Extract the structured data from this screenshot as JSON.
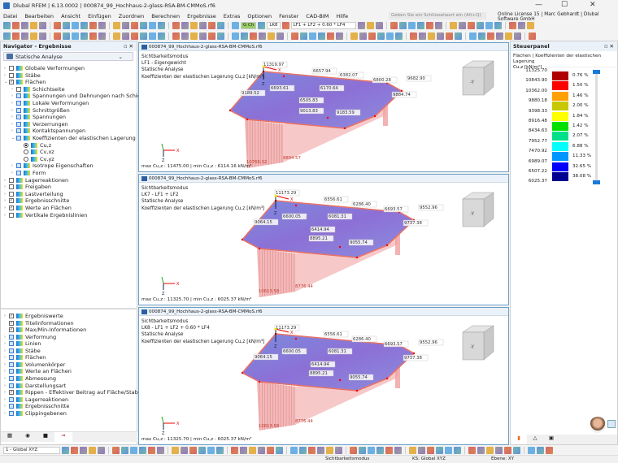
{
  "window": {
    "title": "Dlubal RFEM | 6.13.0002 | 000874_99_Hochhaus-2-glass-RSA-BM-CMMoS.rf6",
    "minimize": "—",
    "maximize": "☐",
    "close": "✕"
  },
  "menu": [
    "Datei",
    "Bearbeiten",
    "Ansicht",
    "Einfügen",
    "Zuordnen",
    "Berechnen",
    "Ergebnisse",
    "Extras",
    "Optionen",
    "Fenster",
    "CAD-BIM",
    "Hilfe"
  ],
  "search": {
    "placeholder": "Geben Sie ein Schlüsselwort ein (Alt+Q)"
  },
  "license": "Online License 15 | Marc Gebhardt | Dlubal Software GmbH",
  "toolbar": {
    "lc_badge": "G Ch",
    "lc_code": "LK8",
    "lc_combo": "LF1 + LF2 + 0.60 * LF4"
  },
  "navigator": {
    "title": "Navigator - Ergebnisse",
    "analysis": "Statische Analyse",
    "tree": [
      {
        "label": "Globale Verformungen",
        "level": 0,
        "check": "off",
        "chev": "›"
      },
      {
        "label": "Stäbe",
        "level": 0,
        "check": "off",
        "chev": "›"
      },
      {
        "label": "Flächen",
        "level": 0,
        "check": "on",
        "chev": "⌄"
      },
      {
        "label": "Schichtseite",
        "level": 1,
        "check": "off",
        "chev": "›"
      },
      {
        "label": "Spannungen und Dehnungen nach Schichtdicken",
        "level": 1,
        "check": "part",
        "chev": "›"
      },
      {
        "label": "Lokale Verformungen",
        "level": 1,
        "check": "part",
        "chev": "›"
      },
      {
        "label": "Schnittgrößen",
        "level": 1,
        "check": "part",
        "chev": "›"
      },
      {
        "label": "Spannungen",
        "level": 1,
        "check": "part",
        "chev": "›"
      },
      {
        "label": "Verzerrungen",
        "level": 1,
        "check": "part",
        "chev": "›"
      },
      {
        "label": "Kontaktspannungen",
        "level": 1,
        "check": "part",
        "chev": "›"
      },
      {
        "label": "Koeffizienten der elastischen Lagerung",
        "level": 1,
        "check": "part",
        "chev": "⌄"
      },
      {
        "label": "Cu,z",
        "level": 2,
        "radio": "on"
      },
      {
        "label": "Cv,xz",
        "level": 2,
        "radio": "off"
      },
      {
        "label": "Cv,yz",
        "level": 2,
        "radio": "off"
      },
      {
        "label": "Isotrope Eigenschaften",
        "level": 1,
        "check": "part",
        "chev": "›"
      },
      {
        "label": "Form",
        "level": 1,
        "check": "part",
        "chev": "›"
      },
      {
        "label": "Lagerreaktionen",
        "level": 0,
        "check": "off",
        "chev": "›"
      },
      {
        "label": "Freigaben",
        "level": 0,
        "check": "off",
        "chev": "›"
      },
      {
        "label": "Lastverteilung",
        "level": 0,
        "check": "off",
        "chev": "›"
      },
      {
        "label": "Ergebnisschnitte",
        "level": 0,
        "check": "on",
        "chev": "›"
      },
      {
        "label": "Werte an Flächen",
        "level": 0,
        "check": "on",
        "chev": "›"
      },
      {
        "label": "Vertikale Ergebnislinien",
        "level": 0,
        "check": "off",
        "chev": "›"
      }
    ],
    "display_tree": [
      {
        "label": "Ergebniswerte",
        "check": "on",
        "chev": "›"
      },
      {
        "label": "Titelinformationen",
        "check": "on",
        "chev": ""
      },
      {
        "label": "Max/Min-Informationen",
        "check": "on",
        "chev": ""
      },
      {
        "label": "Verformung",
        "check": "part",
        "chev": "›"
      },
      {
        "label": "Linien",
        "check": "part",
        "chev": "›"
      },
      {
        "label": "Stäbe",
        "check": "part",
        "chev": "›"
      },
      {
        "label": "Flächen",
        "check": "part",
        "chev": "›"
      },
      {
        "label": "Volumenkörper",
        "check": "part",
        "chev": "›"
      },
      {
        "label": "Werte an Flächen",
        "check": "part",
        "chev": "›"
      },
      {
        "label": "Abmessung",
        "check": "part",
        "chev": "›"
      },
      {
        "label": "Darstellungsart",
        "check": "part",
        "chev": "›"
      },
      {
        "label": "Rippen - Effektiver Beitrag auf Fläche/Stab",
        "check": "on",
        "chev": "›"
      },
      {
        "label": "Lagerreaktionen",
        "check": "part",
        "chev": "›"
      },
      {
        "label": "Ergebnisschnitte",
        "check": "part",
        "chev": "›"
      },
      {
        "label": "Clippingebenen",
        "check": "part",
        "chev": "›"
      }
    ],
    "coord_system": "1 - Global XYZ"
  },
  "views": [
    {
      "file": "000874_99_Hochhaus-2-glass-RSA-BM-CMMoS.rf6",
      "lines": [
        "Sichtbarkeitsmodus",
        "LF1 - Eigengewicht",
        "Statische Analyse",
        "Koeffizienten der elastischen Lagerung Cu,z [kN/m³]"
      ],
      "footer": "max Cu,z : 11475.00 | min Cu,z : 6114.16 kN/m³",
      "labels": [
        "11319.97",
        "6657.94",
        "6382.07",
        "6800.28",
        "9682.90",
        "6693.61",
        "6170.64",
        "9189.52",
        "9884.74",
        "6505.83",
        "9013.83",
        "9183.59"
      ],
      "red_labels": [
        "10766.32",
        "8894.57"
      ]
    },
    {
      "file": "000874_99_Hochhaus-2-glass-RSA-BM-CMMoS.rf6",
      "lines": [
        "Sichtbarkeitsmodus",
        "LK7 - LF1 + LF2",
        "Statische Analyse",
        "Koeffizienten der elastischen Lagerung Cu,z [kN/m³]"
      ],
      "footer": "max Cu,z : 11325.70 | min Cu,z : 6025.37 kN/m³",
      "labels": [
        "11173.29",
        "6556.61",
        "6286.40",
        "6693.57",
        "9552.96",
        "6600.05",
        "6081.31",
        "9064.15",
        "9737.38",
        "6414.94",
        "8895.21",
        "9055.74"
      ],
      "red_labels": [
        "10613.58",
        "8776.44"
      ]
    },
    {
      "file": "000874_99_Hochhaus-2-glass-RSA-BM-CMMoS.rf6",
      "lines": [
        "Sichtbarkeitsmodus",
        "LK8 - LF1 + LF2 + 0.60 * LF4",
        "Statische Analyse",
        "Koeffizienten der elastischen Lagerung Cu,z [kN/m³]"
      ],
      "footer": "max Cu,z : 11325.70 | min Cu,z : 6025.37 kN/m³",
      "labels": [
        "11173.29",
        "6556.61",
        "6286.40",
        "6693.57",
        "9552.96",
        "6600.05",
        "6081.31",
        "9064.15",
        "9737.38",
        "6414.94",
        "8895.21",
        "9055.74"
      ],
      "red_labels": [
        "10613.58",
        "8776.44"
      ]
    }
  ],
  "axes": {
    "x": "X",
    "z": "Z"
  },
  "cube_face": "-Y",
  "control_panel": {
    "title": "Steuerpanel",
    "subtitle": "Flächen | Koeffizienten der elastischen Lagerung",
    "quantity": "Cu,z [kN/m²]",
    "values": [
      "11325.70",
      "10843.90",
      "10362.00",
      "9880.18",
      "9398.33",
      "8916.48",
      "8434.63",
      "7952.77",
      "7470.92",
      "6989.07",
      "6507.22",
      "6025.37"
    ],
    "percents": [
      "0.76 %",
      "1.50 %",
      "1.46 %",
      "2.00 %",
      "1.84 %",
      "1.42 %",
      "2.07 %",
      "6.88 %",
      "11.33 %",
      "32.65 %",
      "38.08 %"
    ],
    "colors": [
      "#b00000",
      "#ff0000",
      "#ffa000",
      "#c8c800",
      "#ffff00",
      "#00e000",
      "#00e08a",
      "#00ffff",
      "#0096ff",
      "#0000ff",
      "#000090"
    ]
  },
  "status": {
    "mode": "Sichtbarkeitsmodus",
    "cs": "KS: Global XYZ",
    "plane": "Ebene: XY"
  }
}
